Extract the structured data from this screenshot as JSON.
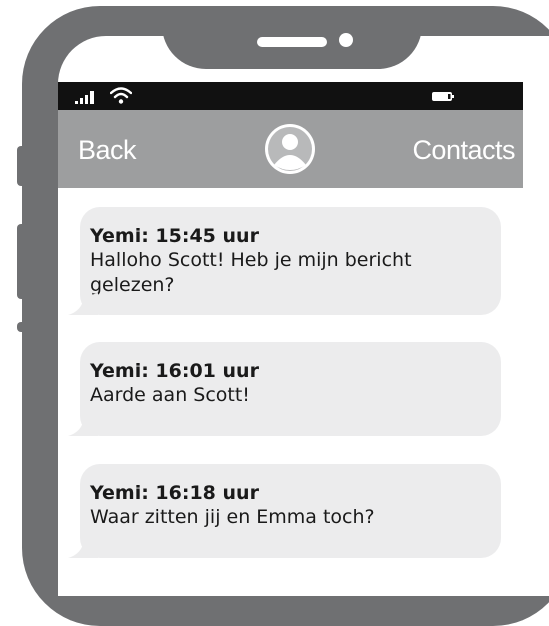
{
  "status_bar": {
    "signal_icon": "signal-bars-icon",
    "wifi_icon": "wifi-icon",
    "battery_icon": "battery-icon"
  },
  "nav": {
    "back_label": "Back",
    "contacts_label": "Contacts",
    "avatar_icon": "user-avatar-icon"
  },
  "messages": [
    {
      "header": "Yemi: 15:45 uur",
      "text": "Halloho Scott! Heb je mijn bericht gelezen?"
    },
    {
      "header": "Yemi: 16:01 uur",
      "text": "Aarde aan Scott!"
    },
    {
      "header": "Yemi: 16:18 uur",
      "text": "Waar zitten jij en Emma toch?"
    }
  ],
  "colors": {
    "frame": "#6f7072",
    "nav_bar": "#9d9e9f",
    "status_bar": "#111111",
    "bubble": "#ececed"
  }
}
